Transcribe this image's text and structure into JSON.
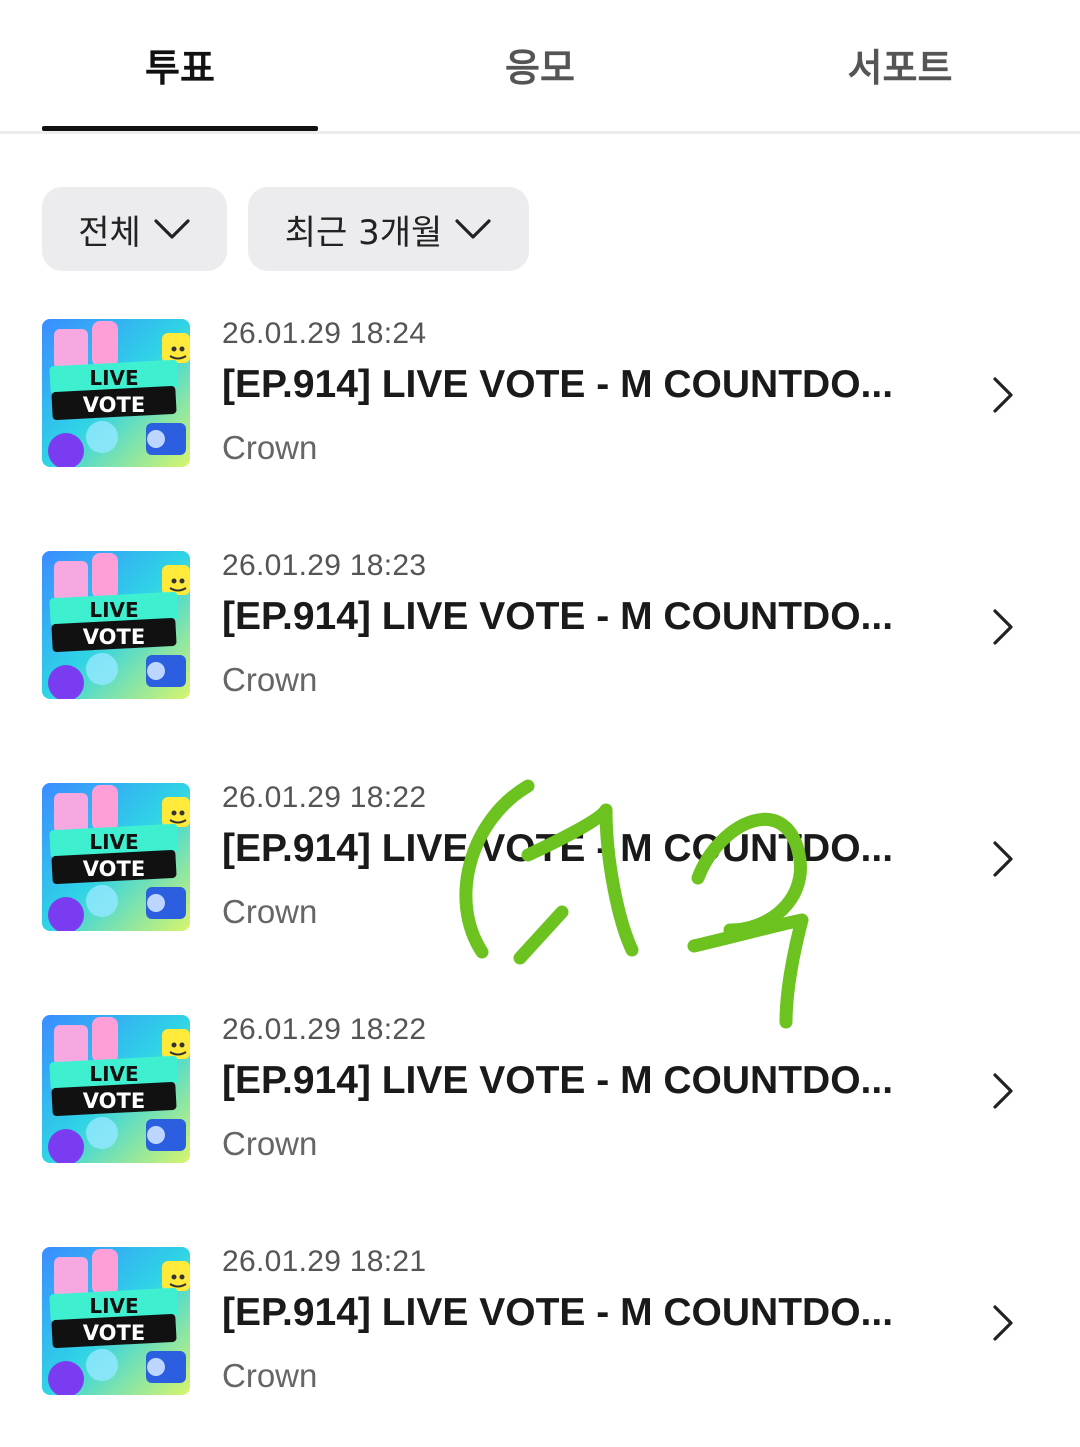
{
  "tabs": [
    {
      "label": "투표",
      "active": true
    },
    {
      "label": "응모",
      "active": false
    },
    {
      "label": "서포트",
      "active": false
    }
  ],
  "filters": {
    "category": "전체",
    "period": "최근 3개월"
  },
  "list": [
    {
      "date": "26.01.29 18:24",
      "title": "[EP.914] LIVE VOTE - M COUNTDO...",
      "subtitle": "Crown"
    },
    {
      "date": "26.01.29 18:23",
      "title": "[EP.914] LIVE VOTE - M COUNTDO...",
      "subtitle": "Crown"
    },
    {
      "date": "26.01.29 18:22",
      "title": "[EP.914] LIVE VOTE - M COUNTDO...",
      "subtitle": "Crown"
    },
    {
      "date": "26.01.29 18:22",
      "title": "[EP.914] LIVE VOTE - M COUNTDO...",
      "subtitle": "Crown"
    },
    {
      "date": "26.01.29 18:21",
      "title": "[EP.914] LIVE VOTE - M COUNTDO...",
      "subtitle": "Crown"
    }
  ],
  "thumbnail": {
    "line1": "LIVE",
    "line2": "VOTE"
  },
  "icons": {
    "dropdown": "chevron-down-icon",
    "item_arrow": "chevron-right-icon"
  },
  "colors": {
    "annotation": "#6cc21f",
    "tab_active": "#111111",
    "filter_bg": "#ececef"
  }
}
